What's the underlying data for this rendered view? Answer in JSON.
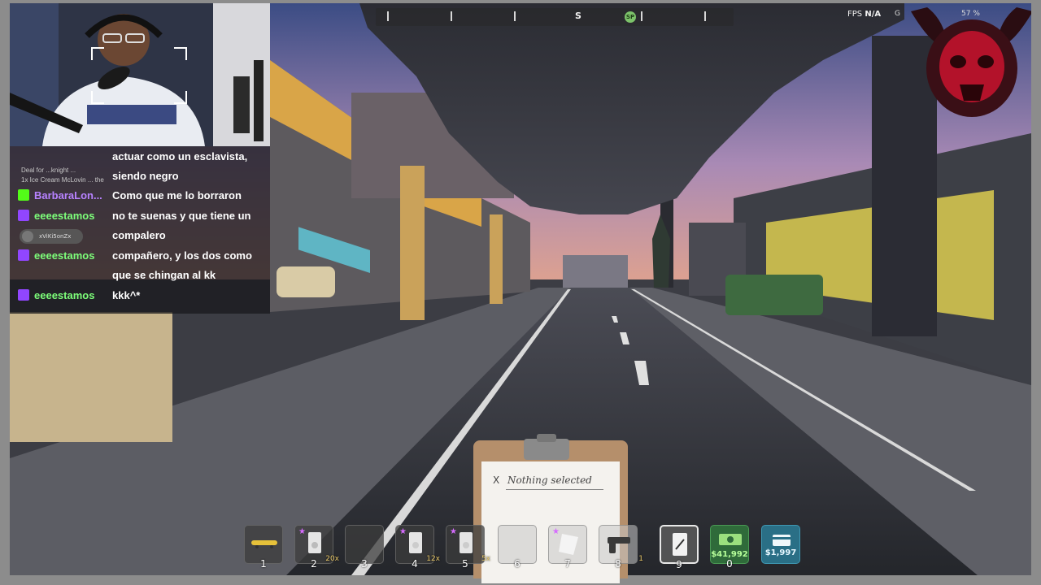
{
  "hud": {
    "compass_dir": "S",
    "compass_marker": "SP",
    "fps_label": "FPS",
    "fps_value": "N/A",
    "extra_left": "G",
    "extra_right": "57 %"
  },
  "chat": {
    "notice_line1": "Deal for ...knight ...",
    "notice_line2": "1x Ice Cream McLovin ... the",
    "badge_name": "xViKi5onZx",
    "messages": [
      {
        "user": "",
        "text_lines": [
          "actuar como un esclavista,",
          "siendo negro"
        ],
        "platform": "none",
        "user_color": "#ffffff"
      },
      {
        "user": "BarbaraLon...",
        "text_lines": [
          "Como que me lo borraron"
        ],
        "platform": "kick",
        "user_color": "#b782ff"
      },
      {
        "user": "eeeestamos",
        "text_lines": [
          "no te suenas y que tiene un",
          "compalero"
        ],
        "platform": "twitch",
        "user_color": "#7dff7a"
      },
      {
        "user": "eeeestamos",
        "text_lines": [
          "compañero, y los dos como",
          "que se chingan al kk"
        ],
        "platform": "twitch",
        "user_color": "#7dff7a"
      },
      {
        "user": "eeeestamos",
        "text_lines": [
          "kkk^*"
        ],
        "platform": "twitch",
        "user_color": "#7dff7a"
      }
    ]
  },
  "clipboard": {
    "close_glyph": "X",
    "status_text": "Nothing selected"
  },
  "hotbar": {
    "slots": [
      {
        "num": "1",
        "item": "skateboard",
        "qty": "",
        "star": false
      },
      {
        "num": "2",
        "item": "baggie",
        "qty": "20x",
        "star": true
      },
      {
        "num": "3",
        "item": "",
        "qty": "",
        "star": false
      },
      {
        "num": "4",
        "item": "baggie",
        "qty": "12x",
        "star": true
      },
      {
        "num": "5",
        "item": "baggie",
        "qty": "5x",
        "star": true
      },
      {
        "num": "6",
        "item": "",
        "qty": "",
        "star": false
      },
      {
        "num": "7",
        "item": "paper",
        "qty": "",
        "star": true
      },
      {
        "num": "8",
        "item": "pistol",
        "qty": "1",
        "star": false
      },
      {
        "num": "9",
        "item": "phone",
        "qty": "",
        "star": false
      },
      {
        "num": "0",
        "item": "cash",
        "money": "$41,992"
      },
      {
        "num": "",
        "item": "card",
        "money": "$1,997"
      }
    ]
  },
  "colors": {
    "sky_top": "#3b4c84",
    "sky_bottom": "#e3a48c",
    "road": "#2e3036",
    "kick_green": "#53fc18",
    "twitch_purple": "#9146ff"
  }
}
